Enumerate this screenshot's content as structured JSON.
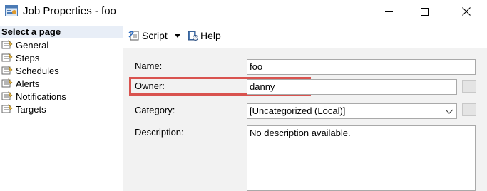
{
  "window": {
    "title": "Job Properties - foo"
  },
  "leftpane": {
    "header": "Select a page",
    "items": [
      {
        "label": "General",
        "icon": "page-icon"
      },
      {
        "label": "Steps",
        "icon": "page-icon"
      },
      {
        "label": "Schedules",
        "icon": "page-icon"
      },
      {
        "label": "Alerts",
        "icon": "page-icon"
      },
      {
        "label": "Notifications",
        "icon": "page-icon"
      },
      {
        "label": "Targets",
        "icon": "page-icon"
      }
    ]
  },
  "toolbar": {
    "script_label": "Script",
    "help_label": "Help"
  },
  "form": {
    "name_label": "Name:",
    "name_value": "foo",
    "owner_label": "Owner:",
    "owner_value": "danny",
    "category_label": "Category:",
    "category_value": "[Uncategorized (Local)]",
    "description_label": "Description:",
    "description_value": "No description available."
  },
  "colors": {
    "highlight": "#d9534f",
    "pane_header": "#e8eef7",
    "content_bg": "#f2f2f2"
  }
}
